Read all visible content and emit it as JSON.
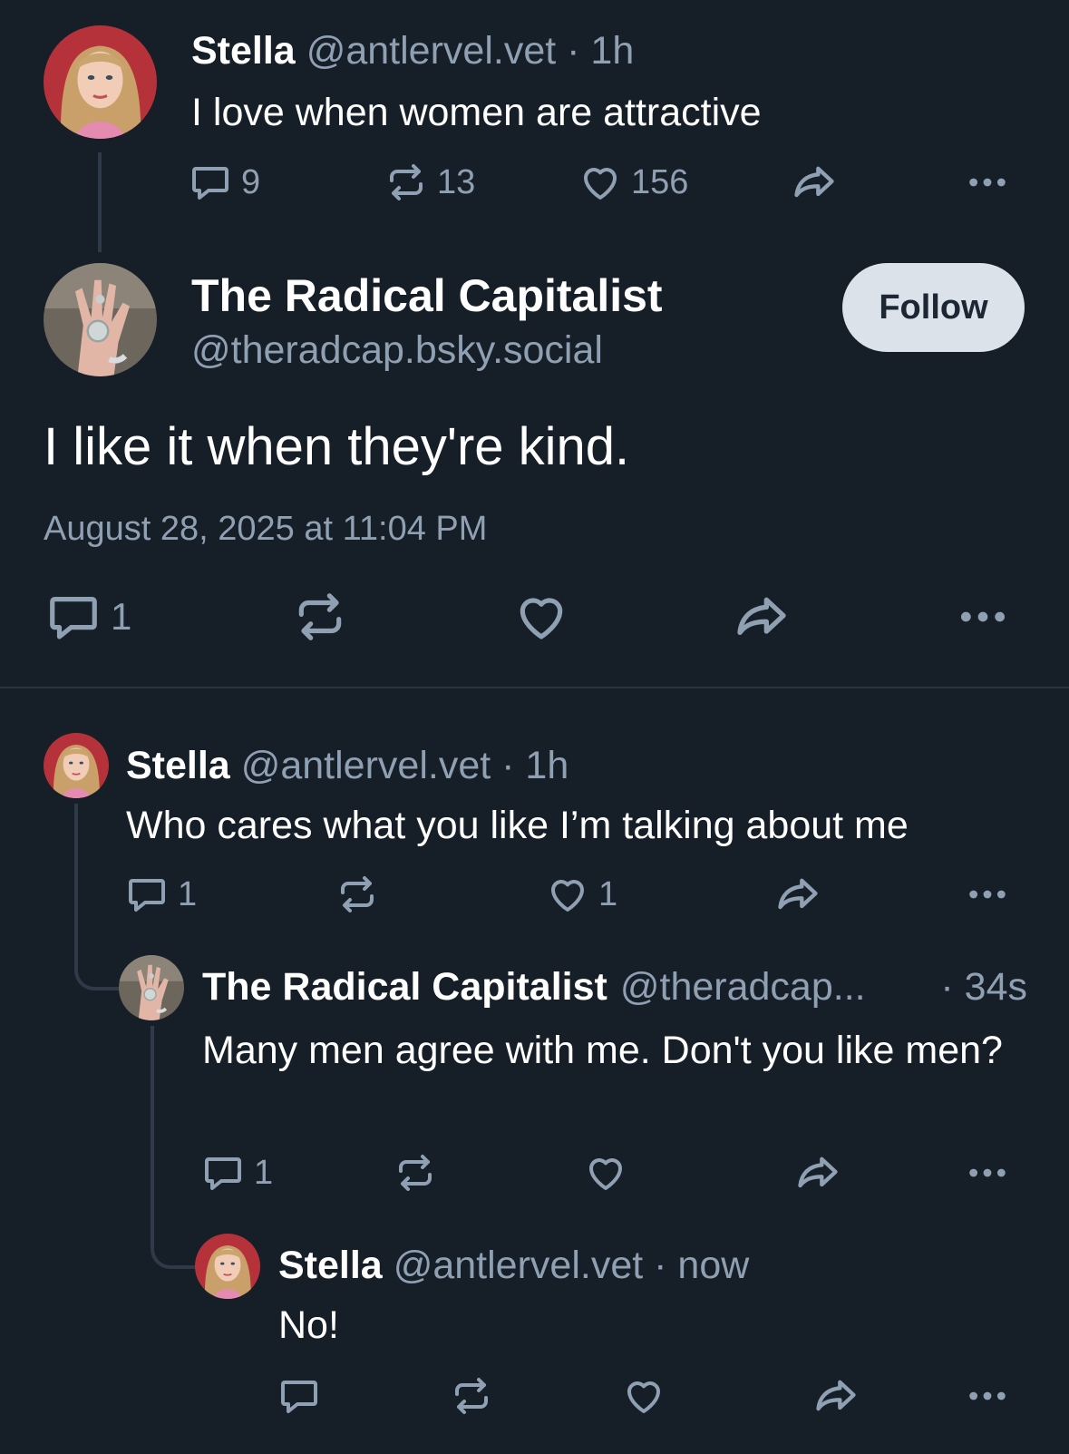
{
  "parent_post": {
    "author_name": "Stella",
    "author_handle": "@antlervel.vet",
    "time": "· 1h",
    "text": "I love when women are attractive",
    "reply_count": "9",
    "repost_count": "13",
    "like_count": "156"
  },
  "main_post": {
    "author_name": "The Radical Capitalist",
    "author_handle": "@theradcap.bsky.social",
    "follow_label": "Follow",
    "text": "I like it when they're kind.",
    "timestamp": "August 28, 2025 at 11:04 PM",
    "reply_count": "1"
  },
  "replies": [
    {
      "author_name": "Stella",
      "author_handle": "@antlervel.vet",
      "time": "· 1h",
      "text": "Who cares what you like I’m talking about me",
      "reply_count": "1",
      "like_count": "1"
    },
    {
      "author_name": "The Radical Capitalist",
      "author_handle": "@theradcap...",
      "time": "· 34s",
      "text": "Many men agree with me. Don't you like men?",
      "reply_count": "1"
    },
    {
      "author_name": "Stella",
      "author_handle": "@antlervel.vet",
      "time": "· now",
      "text": "No!"
    }
  ],
  "icons": [
    "reply-icon",
    "repost-icon",
    "like-icon",
    "share-icon",
    "more-icon"
  ],
  "colors": {
    "background": "#161e27",
    "muted": "#8fa0b3",
    "follow_button": "#dce2ea"
  }
}
